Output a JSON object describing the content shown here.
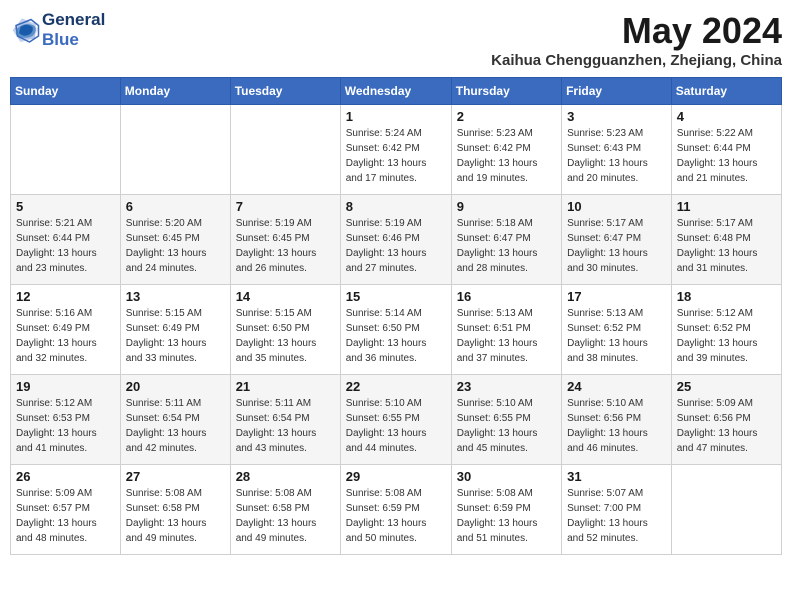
{
  "header": {
    "logo_line1": "General",
    "logo_line2": "Blue",
    "month": "May 2024",
    "location": "Kaihua Chengguanzhen, Zhejiang, China"
  },
  "days_header": [
    "Sunday",
    "Monday",
    "Tuesday",
    "Wednesday",
    "Thursday",
    "Friday",
    "Saturday"
  ],
  "weeks": [
    {
      "shade": "white",
      "cells": [
        {
          "day": "",
          "detail": ""
        },
        {
          "day": "",
          "detail": ""
        },
        {
          "day": "",
          "detail": ""
        },
        {
          "day": "1",
          "detail": "Sunrise: 5:24 AM\nSunset: 6:42 PM\nDaylight: 13 hours\nand 17 minutes."
        },
        {
          "day": "2",
          "detail": "Sunrise: 5:23 AM\nSunset: 6:42 PM\nDaylight: 13 hours\nand 19 minutes."
        },
        {
          "day": "3",
          "detail": "Sunrise: 5:23 AM\nSunset: 6:43 PM\nDaylight: 13 hours\nand 20 minutes."
        },
        {
          "day": "4",
          "detail": "Sunrise: 5:22 AM\nSunset: 6:44 PM\nDaylight: 13 hours\nand 21 minutes."
        }
      ]
    },
    {
      "shade": "shaded",
      "cells": [
        {
          "day": "5",
          "detail": "Sunrise: 5:21 AM\nSunset: 6:44 PM\nDaylight: 13 hours\nand 23 minutes."
        },
        {
          "day": "6",
          "detail": "Sunrise: 5:20 AM\nSunset: 6:45 PM\nDaylight: 13 hours\nand 24 minutes."
        },
        {
          "day": "7",
          "detail": "Sunrise: 5:19 AM\nSunset: 6:45 PM\nDaylight: 13 hours\nand 26 minutes."
        },
        {
          "day": "8",
          "detail": "Sunrise: 5:19 AM\nSunset: 6:46 PM\nDaylight: 13 hours\nand 27 minutes."
        },
        {
          "day": "9",
          "detail": "Sunrise: 5:18 AM\nSunset: 6:47 PM\nDaylight: 13 hours\nand 28 minutes."
        },
        {
          "day": "10",
          "detail": "Sunrise: 5:17 AM\nSunset: 6:47 PM\nDaylight: 13 hours\nand 30 minutes."
        },
        {
          "day": "11",
          "detail": "Sunrise: 5:17 AM\nSunset: 6:48 PM\nDaylight: 13 hours\nand 31 minutes."
        }
      ]
    },
    {
      "shade": "white",
      "cells": [
        {
          "day": "12",
          "detail": "Sunrise: 5:16 AM\nSunset: 6:49 PM\nDaylight: 13 hours\nand 32 minutes."
        },
        {
          "day": "13",
          "detail": "Sunrise: 5:15 AM\nSunset: 6:49 PM\nDaylight: 13 hours\nand 33 minutes."
        },
        {
          "day": "14",
          "detail": "Sunrise: 5:15 AM\nSunset: 6:50 PM\nDaylight: 13 hours\nand 35 minutes."
        },
        {
          "day": "15",
          "detail": "Sunrise: 5:14 AM\nSunset: 6:50 PM\nDaylight: 13 hours\nand 36 minutes."
        },
        {
          "day": "16",
          "detail": "Sunrise: 5:13 AM\nSunset: 6:51 PM\nDaylight: 13 hours\nand 37 minutes."
        },
        {
          "day": "17",
          "detail": "Sunrise: 5:13 AM\nSunset: 6:52 PM\nDaylight: 13 hours\nand 38 minutes."
        },
        {
          "day": "18",
          "detail": "Sunrise: 5:12 AM\nSunset: 6:52 PM\nDaylight: 13 hours\nand 39 minutes."
        }
      ]
    },
    {
      "shade": "shaded",
      "cells": [
        {
          "day": "19",
          "detail": "Sunrise: 5:12 AM\nSunset: 6:53 PM\nDaylight: 13 hours\nand 41 minutes."
        },
        {
          "day": "20",
          "detail": "Sunrise: 5:11 AM\nSunset: 6:54 PM\nDaylight: 13 hours\nand 42 minutes."
        },
        {
          "day": "21",
          "detail": "Sunrise: 5:11 AM\nSunset: 6:54 PM\nDaylight: 13 hours\nand 43 minutes."
        },
        {
          "day": "22",
          "detail": "Sunrise: 5:10 AM\nSunset: 6:55 PM\nDaylight: 13 hours\nand 44 minutes."
        },
        {
          "day": "23",
          "detail": "Sunrise: 5:10 AM\nSunset: 6:55 PM\nDaylight: 13 hours\nand 45 minutes."
        },
        {
          "day": "24",
          "detail": "Sunrise: 5:10 AM\nSunset: 6:56 PM\nDaylight: 13 hours\nand 46 minutes."
        },
        {
          "day": "25",
          "detail": "Sunrise: 5:09 AM\nSunset: 6:56 PM\nDaylight: 13 hours\nand 47 minutes."
        }
      ]
    },
    {
      "shade": "white",
      "cells": [
        {
          "day": "26",
          "detail": "Sunrise: 5:09 AM\nSunset: 6:57 PM\nDaylight: 13 hours\nand 48 minutes."
        },
        {
          "day": "27",
          "detail": "Sunrise: 5:08 AM\nSunset: 6:58 PM\nDaylight: 13 hours\nand 49 minutes."
        },
        {
          "day": "28",
          "detail": "Sunrise: 5:08 AM\nSunset: 6:58 PM\nDaylight: 13 hours\nand 49 minutes."
        },
        {
          "day": "29",
          "detail": "Sunrise: 5:08 AM\nSunset: 6:59 PM\nDaylight: 13 hours\nand 50 minutes."
        },
        {
          "day": "30",
          "detail": "Sunrise: 5:08 AM\nSunset: 6:59 PM\nDaylight: 13 hours\nand 51 minutes."
        },
        {
          "day": "31",
          "detail": "Sunrise: 5:07 AM\nSunset: 7:00 PM\nDaylight: 13 hours\nand 52 minutes."
        },
        {
          "day": "",
          "detail": ""
        }
      ]
    }
  ]
}
